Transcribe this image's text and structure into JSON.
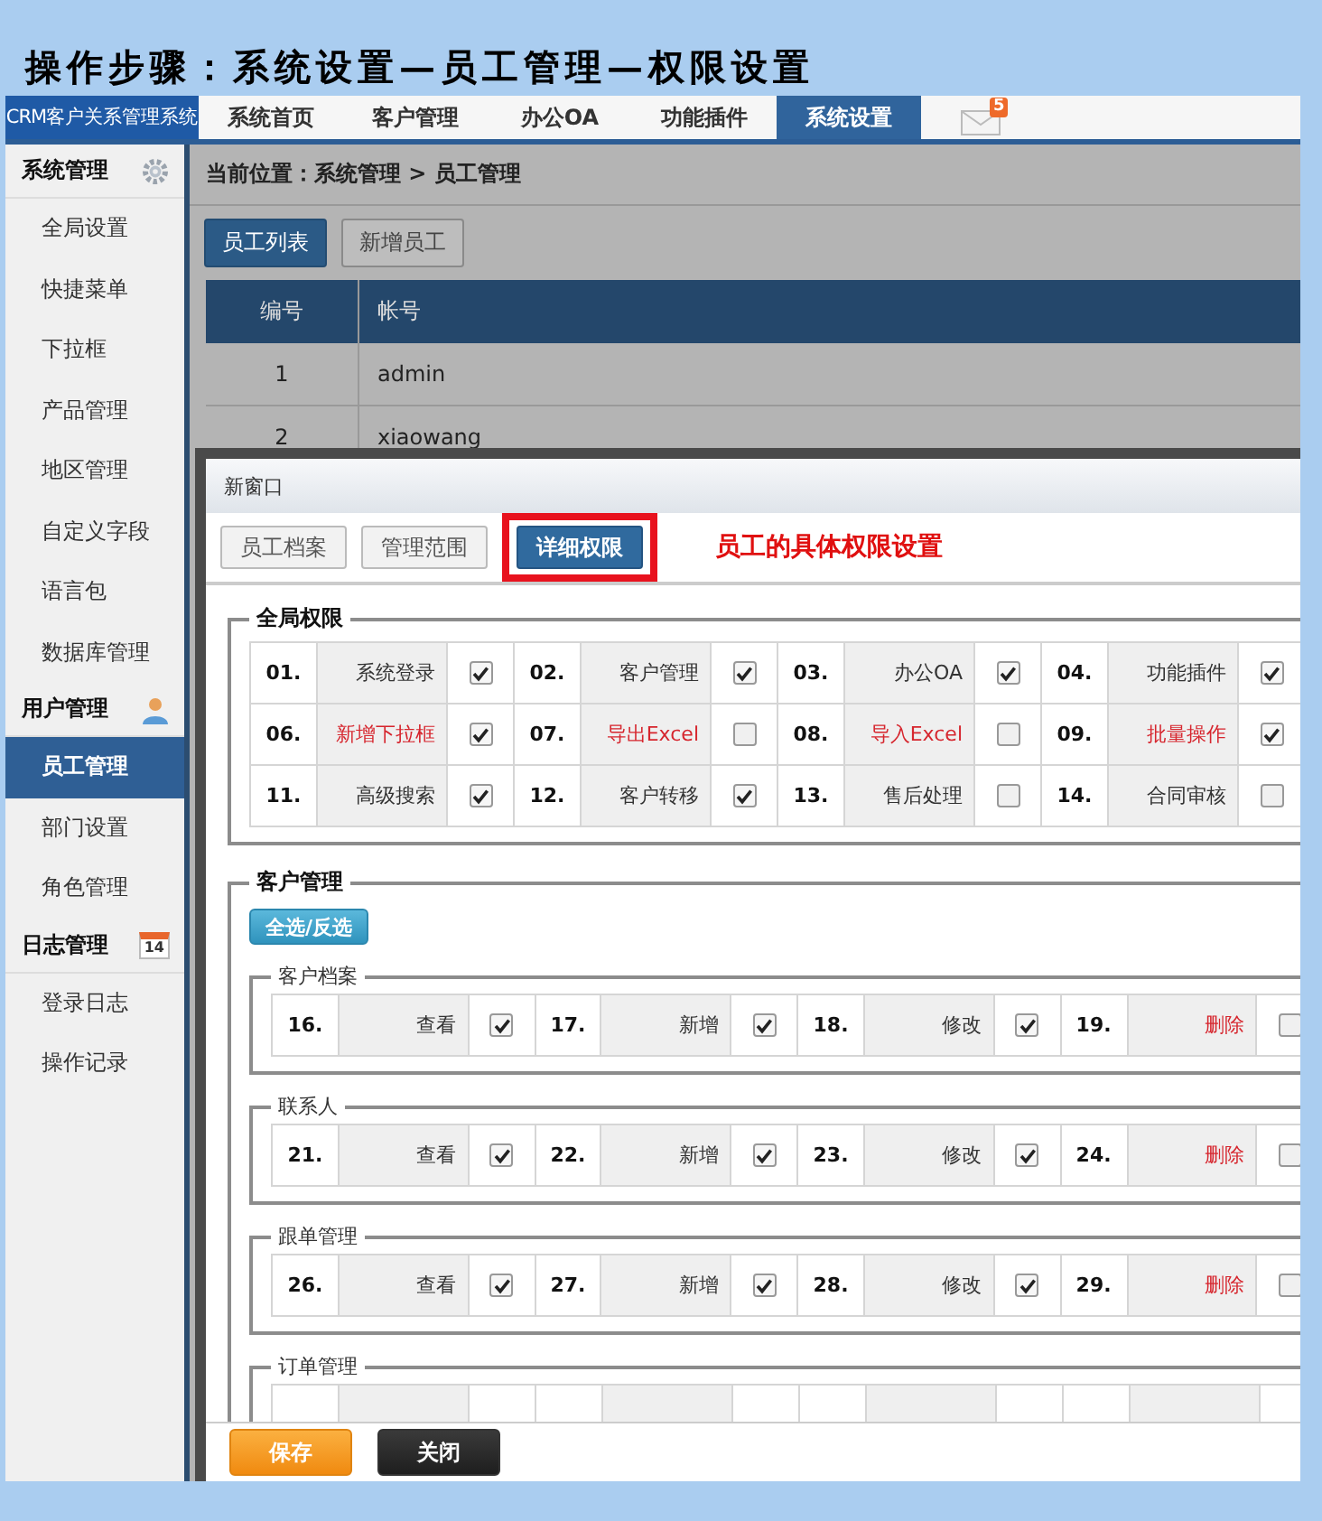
{
  "page_title": "操作步骤：系统设置—员工管理—权限设置",
  "app": {
    "logo": "CRM客户关系管理系统",
    "nav": [
      {
        "label": "系统首页",
        "selected": false
      },
      {
        "label": "客户管理",
        "selected": false
      },
      {
        "label": "办公OA",
        "selected": false
      },
      {
        "label": "功能插件",
        "selected": false
      },
      {
        "label": "系统设置",
        "selected": true
      }
    ],
    "mail_badge": "5"
  },
  "sidebar": {
    "groups": [
      {
        "title": "系统管理",
        "kind": "settings",
        "items": [
          {
            "label": "全局设置",
            "selected": false
          },
          {
            "label": "快捷菜单",
            "selected": false
          },
          {
            "label": "下拉框",
            "selected": false
          },
          {
            "label": "产品管理",
            "selected": false
          },
          {
            "label": "地区管理",
            "selected": false
          },
          {
            "label": "自定义字段",
            "selected": false
          },
          {
            "label": "语言包",
            "selected": false
          },
          {
            "label": "数据库管理",
            "selected": false
          }
        ]
      },
      {
        "title": "用户管理",
        "kind": "user",
        "items": [
          {
            "label": "员工管理",
            "selected": true
          },
          {
            "label": "部门设置",
            "selected": false
          },
          {
            "label": "角色管理",
            "selected": false
          }
        ]
      },
      {
        "title": "日志管理",
        "kind": "calendar",
        "day": "14",
        "items": [
          {
            "label": "登录日志",
            "selected": false
          },
          {
            "label": "操作记录",
            "selected": false
          }
        ]
      }
    ]
  },
  "breadcrumb": "当前位置：系统管理 > 员工管理",
  "list_tabs": [
    {
      "label": "员工列表",
      "selected": true
    },
    {
      "label": "新增员工",
      "selected": false
    }
  ],
  "table": {
    "columns": [
      "编号",
      "帐号"
    ],
    "rows": [
      [
        "1",
        "admin"
      ],
      [
        "2",
        "xiaowang"
      ]
    ]
  },
  "dialog": {
    "title": "新窗口",
    "tabs": [
      {
        "label": "员工档案",
        "selected": false,
        "highlighted": false
      },
      {
        "label": "管理范围",
        "selected": false,
        "highlighted": false
      },
      {
        "label": "详细权限",
        "selected": true,
        "highlighted": true
      }
    ],
    "annotation": "员工的具体权限设置",
    "global": {
      "legend": "全局权限",
      "rows": [
        [
          {
            "num": "01.",
            "label": "系统登录",
            "color": "#333333",
            "checked": true
          },
          {
            "num": "02.",
            "label": "客户管理",
            "color": "#333333",
            "checked": true
          },
          {
            "num": "03.",
            "label": "办公OA",
            "color": "#333333",
            "checked": true
          },
          {
            "num": "04.",
            "label": "功能插件",
            "color": "#333333",
            "checked": true
          }
        ],
        [
          {
            "num": "06.",
            "label": "新增下拉框",
            "color": "#d6262e",
            "checked": true
          },
          {
            "num": "07.",
            "label": "导出Excel",
            "color": "#d6262e",
            "checked": false
          },
          {
            "num": "08.",
            "label": "导入Excel",
            "color": "#d6262e",
            "checked": false
          },
          {
            "num": "09.",
            "label": "批量操作",
            "color": "#d6262e",
            "checked": true
          }
        ],
        [
          {
            "num": "11.",
            "label": "高级搜索",
            "color": "#333333",
            "checked": true
          },
          {
            "num": "12.",
            "label": "客户转移",
            "color": "#333333",
            "checked": true
          },
          {
            "num": "13.",
            "label": "售后处理",
            "color": "#333333",
            "checked": false
          },
          {
            "num": "14.",
            "label": "合同审核",
            "color": "#333333",
            "checked": false
          }
        ]
      ]
    },
    "customer": {
      "legend": "客户管理",
      "toggle_all": "全选/反选",
      "sections": [
        {
          "legend": "客户档案",
          "items": [
            {
              "num": "16.",
              "label": "查看",
              "color": "#333333",
              "checked": true
            },
            {
              "num": "17.",
              "label": "新增",
              "color": "#333333",
              "checked": true
            },
            {
              "num": "18.",
              "label": "修改",
              "color": "#333333",
              "checked": true
            },
            {
              "num": "19.",
              "label": "删除",
              "color": "#d6262e",
              "checked": false
            }
          ]
        },
        {
          "legend": "联系人",
          "items": [
            {
              "num": "21.",
              "label": "查看",
              "color": "#333333",
              "checked": true
            },
            {
              "num": "22.",
              "label": "新增",
              "color": "#333333",
              "checked": true
            },
            {
              "num": "23.",
              "label": "修改",
              "color": "#333333",
              "checked": true
            },
            {
              "num": "24.",
              "label": "删除",
              "color": "#d6262e",
              "checked": false
            }
          ]
        },
        {
          "legend": "跟单管理",
          "items": [
            {
              "num": "26.",
              "label": "查看",
              "color": "#333333",
              "checked": true
            },
            {
              "num": "27.",
              "label": "新增",
              "color": "#333333",
              "checked": true
            },
            {
              "num": "28.",
              "label": "修改",
              "color": "#333333",
              "checked": true
            },
            {
              "num": "29.",
              "label": "删除",
              "color": "#d6262e",
              "checked": false
            }
          ]
        },
        {
          "legend": "订单管理"
        }
      ]
    },
    "buttons": [
      {
        "label": "保存",
        "kind": "primary"
      },
      {
        "label": "关闭",
        "kind": "dark"
      }
    ]
  }
}
